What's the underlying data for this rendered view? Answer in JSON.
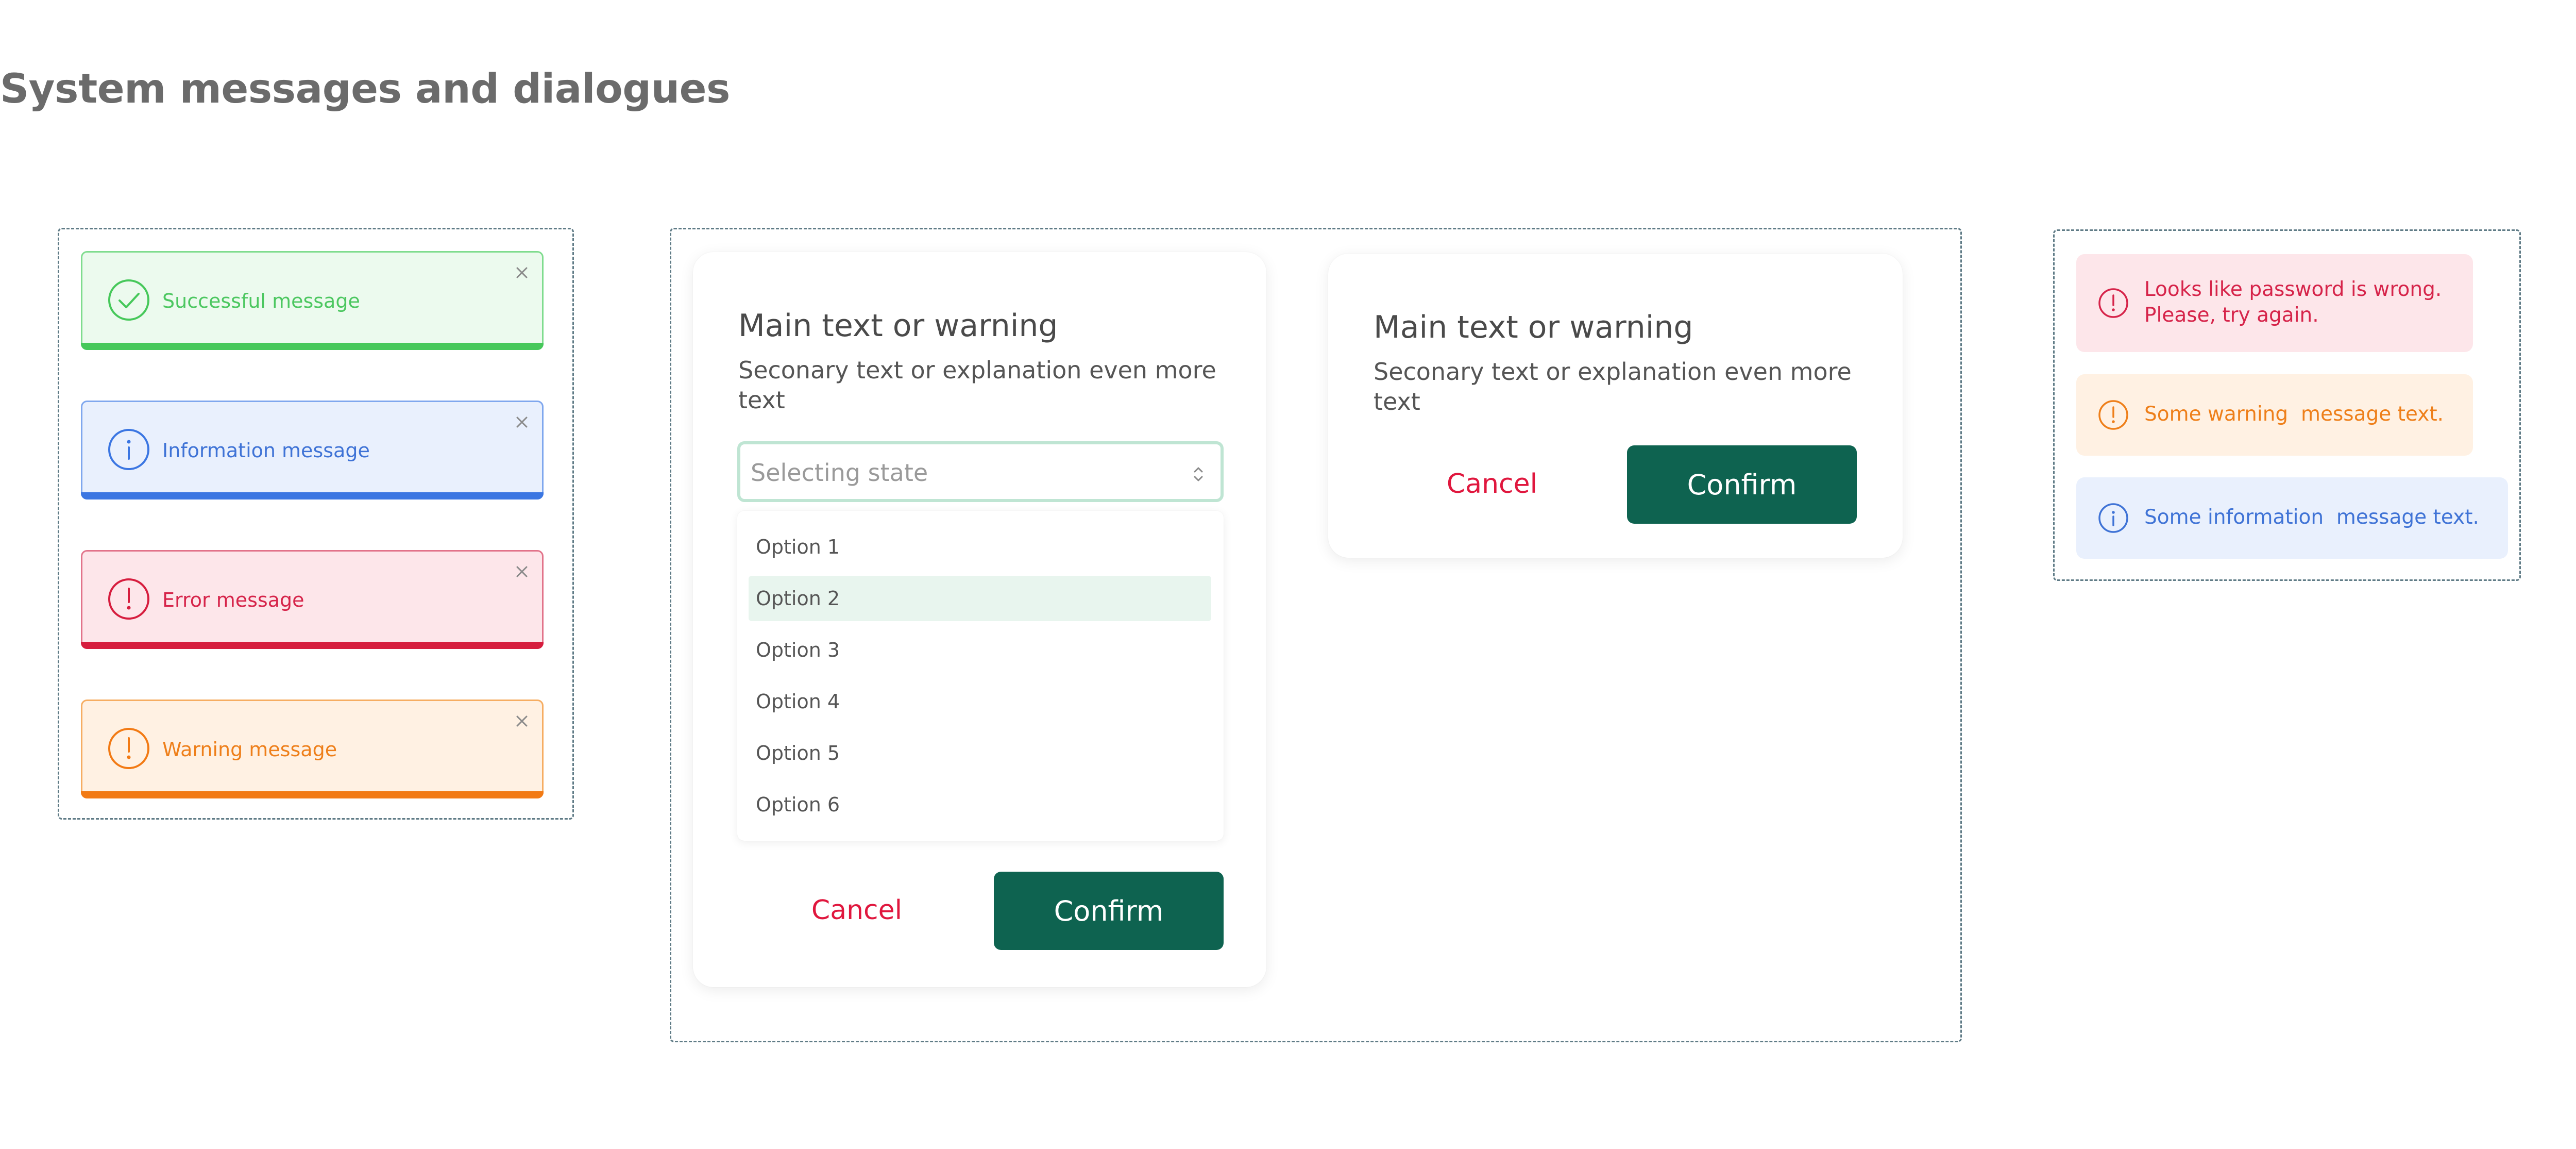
{
  "page": {
    "title": "System messages and dialogues"
  },
  "toasts": [
    {
      "type": "success",
      "text": "Successful message",
      "icon": "check-circle-icon",
      "color": "#46c85a"
    },
    {
      "type": "info",
      "text": "Information message",
      "icon": "info-circle-icon",
      "color": "#3b76e2"
    },
    {
      "type": "error",
      "text": "Error message",
      "icon": "exclamation-circle-icon",
      "color": "#d61d3e"
    },
    {
      "type": "warning",
      "text": "Warning message",
      "icon": "exclamation-circle-icon",
      "color": "#f27a14"
    }
  ],
  "dialog_select": {
    "title": "Main text or warning",
    "subtitle": "Seconary text or explanation even more text",
    "select_value": "Selecting state",
    "options": [
      "Option 1",
      "Option 2",
      "Option 3",
      "Option 4",
      "Option 5",
      "Option 6"
    ],
    "selected_option": "Option 2",
    "cancel_label": "Cancel",
    "confirm_label": "Confirm"
  },
  "dialog_simple": {
    "title": "Main text or warning",
    "subtitle": "Seconary text or explanation even more text",
    "cancel_label": "Cancel",
    "confirm_label": "Confirm"
  },
  "inline_messages": {
    "error": {
      "line1": "Looks like password is wrong.",
      "line2": "Please, try again.",
      "color": "#d6244a"
    },
    "warning": {
      "text": "Some warning  message text.",
      "color": "#ee7f1a"
    },
    "info": {
      "text": "Some information  message text.",
      "color": "#3f73d6"
    }
  },
  "colors": {
    "primary": "#0e6350",
    "danger": "#e0173e",
    "select_focus_border": "#bfe5d3",
    "selected_option_bg": "#e8f5ee"
  }
}
